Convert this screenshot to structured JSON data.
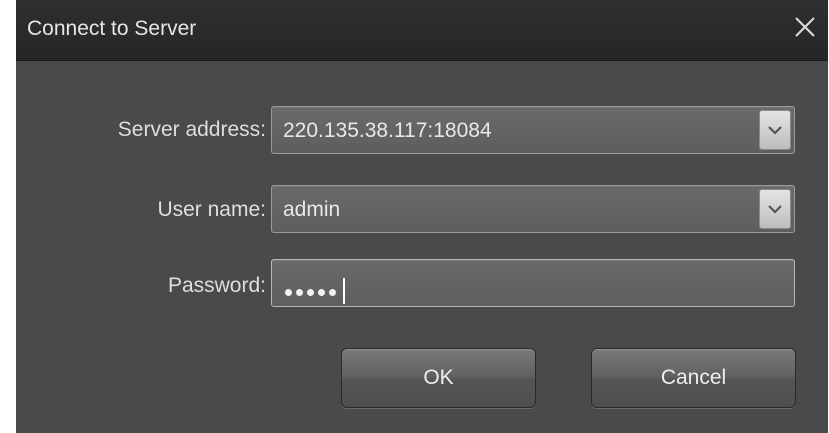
{
  "dialog": {
    "title": "Connect to Server",
    "close_icon": "close-icon"
  },
  "form": {
    "server_address": {
      "label": "Server address:",
      "value": "220.135.38.117:18084",
      "icon": "chevron-down-icon"
    },
    "user_name": {
      "label": "User name:",
      "value": "admin",
      "icon": "chevron-down-icon"
    },
    "password": {
      "label": "Password:",
      "masked_length": 5
    }
  },
  "buttons": {
    "ok_label": "OK",
    "cancel_label": "Cancel"
  },
  "colors": {
    "dialog_bg": "#4a4a4a",
    "titlebar_bg": "#2b2b2b",
    "field_bg": "#636363",
    "text": "#e0e0e0"
  }
}
